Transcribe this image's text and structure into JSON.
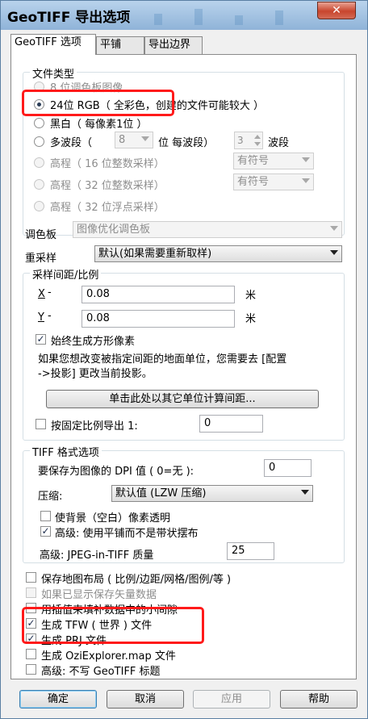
{
  "window": {
    "title": "GeoTIFF 导出选项",
    "close_glyph": "✕"
  },
  "tabs": [
    {
      "label": "GeoTIFF 选项"
    },
    {
      "label": "平铺"
    },
    {
      "label": "导出边界"
    }
  ],
  "file_type": {
    "label": "文件类型",
    "palette": "8 位调色板图像",
    "rgb24": "24位 RGB（ 全彩色，创建的文件可能较大 ）",
    "grayscale": "黑白（ 每像素1位 ）",
    "multiband": "多波段（",
    "multiband_bits": "8",
    "multiband_bits_unit": "位  每波段）",
    "band_count": "3",
    "band_label": "波段",
    "elev16": "高程（ 16 位整数采样）",
    "elev16_sign": "有符号",
    "elev32": "高程（ 32 位整数采样）",
    "elev32_sign": "有符号",
    "elev32f": "高程（ 32 位浮点采样）"
  },
  "palette": {
    "label": "调色板",
    "value": "图像优化调色板"
  },
  "resample": {
    "label": "重采样",
    "value": "默认(如果需要重新取样)"
  },
  "spacing": {
    "label": "采样间距/比例",
    "x_label": "X",
    "x_value": "0.08",
    "y_label": "Y",
    "y_value": "0.08",
    "unit": "米",
    "square_pixels": "始终生成方形像素",
    "note_line1": "如果您想改变被指定间距的地面单位，您需要去 [配置",
    "note_line2": "->投影] 更改当前投影。",
    "calc_button": "单击此处以其它单位计算间距...",
    "fixed_scale": "按固定比例导出 1:",
    "fixed_scale_value": "0"
  },
  "tiff": {
    "label": "TIFF 格式选项",
    "dpi_label": "要保存为图像的 DPI 值 ( 0=无 ):",
    "dpi_value": "0",
    "compress_label": "压缩:",
    "compress_value": "默认值 (LZW 压缩)",
    "transparent": "使背景（空白）像素透明",
    "tiled": "高级: 使用平铺而不是带状摆布",
    "jpeg_label": "高级: JPEG-in-TIFF 质量",
    "jpeg_value": "25"
  },
  "options": {
    "save_layout": "保存地图布局 ( 比例/边距/网格/图例/等 )",
    "vector_data": "如果已显示保存矢量数据",
    "interpolate": "用插值来填补数据中的小间隙",
    "tfw": "生成 TFW ( 世界 ) 文件",
    "prj": "生成 PRJ 文件",
    "ozi": "生成 OziExplorer.map 文件",
    "no_header": "高级: 不写 GeoTIFF 标题"
  },
  "buttons": {
    "ok": "确定",
    "cancel": "取消",
    "apply": "应用",
    "help": "帮助"
  },
  "colors": {
    "highlight": "#ff1a1a",
    "title_gradient_top": "#b9d3ec",
    "close_red": "#c8452d"
  }
}
